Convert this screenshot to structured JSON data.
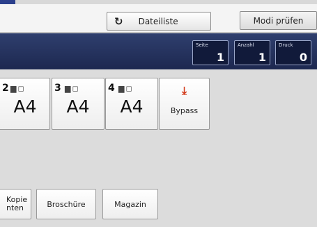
{
  "toolbar": {
    "file_list_icon": "↻",
    "file_list_label": "Dateiliste",
    "check_modes_label": "Modi prüfen"
  },
  "counters": {
    "page": {
      "label": "Seite",
      "value": "1"
    },
    "count": {
      "label": "Anzahl",
      "value": "1"
    },
    "print": {
      "label": "Druck",
      "value": "0"
    }
  },
  "trays": [
    {
      "number": "2",
      "size": "A4"
    },
    {
      "number": "3",
      "size": "A4"
    },
    {
      "number": "4",
      "size": "A4"
    }
  ],
  "bypass": {
    "icon": "bypass-tray-icon",
    "label": "Bypass"
  },
  "bottom_buttons": {
    "copy_line1": "Kopie",
    "copy_line2": "nten",
    "brochure": "Broschüre",
    "magazine": "Magazin"
  },
  "colors": {
    "status_bar": "#1d2850",
    "accent_red": "#d23a1a",
    "corner_mark": "#2b3f8c"
  }
}
